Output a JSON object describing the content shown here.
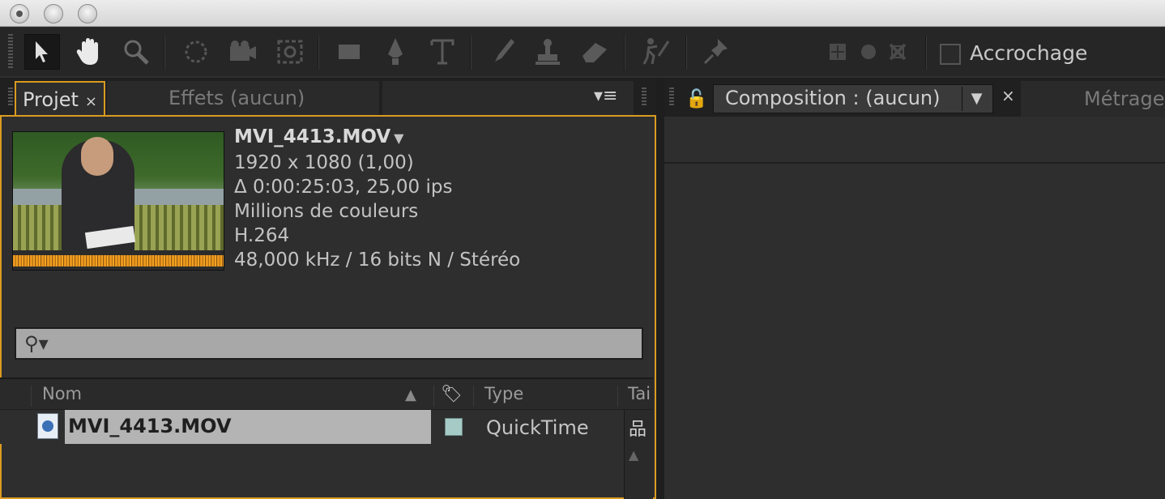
{
  "toolbar": {
    "snap_label": "Accrochage"
  },
  "project_panel": {
    "tabs": [
      "Projet",
      "Effets (aucun)"
    ],
    "close_glyph": "×",
    "menu_glyph": "▾≡",
    "selected": {
      "name": "MVI_4413.MOV",
      "resolution": "1920 x 1080 (1,00)",
      "duration": "Δ 0:00:25:03, 25,00 ips",
      "colors": "Millions de couleurs",
      "codec": "H.264",
      "audio": "48,000 kHz / 16 bits N / Stéréo"
    },
    "search": {
      "icon_glyph": "⚲▾"
    },
    "columns": [
      "Nom",
      "Type",
      "Tai"
    ],
    "sort_glyph": "▲",
    "label_glyph": "🏷",
    "rows": [
      {
        "name": "MVI_4413.MOV",
        "type": "QuickTime"
      }
    ],
    "flowchart_glyph": "品",
    "scroll_up_glyph": "▲"
  },
  "composition_panel": {
    "lock_glyph": "🔓",
    "tab_label": "Composition : (aucun)",
    "dropdown_glyph": "▼",
    "close_glyph": "×",
    "next_tab": "Métrage"
  },
  "colors": {
    "accent": "#d99b21",
    "row_highlight": "#b4b4b4",
    "label_swatch": "#a6cbc6"
  }
}
